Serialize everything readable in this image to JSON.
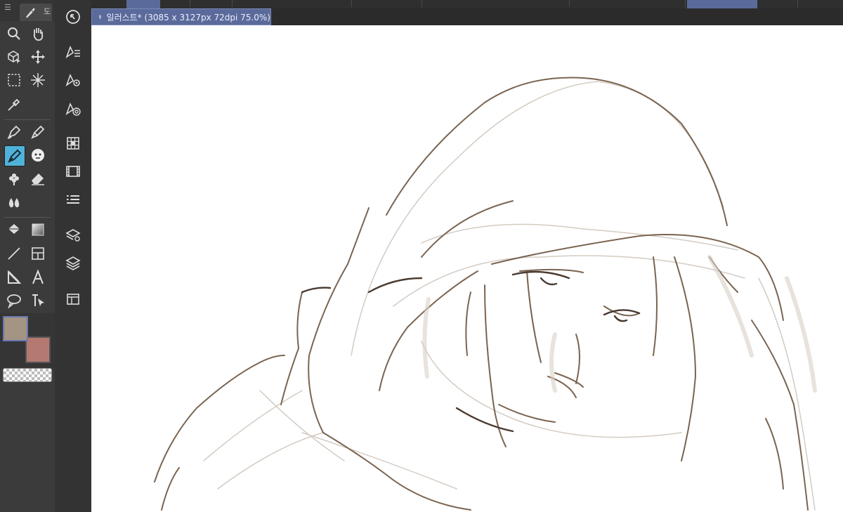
{
  "left_panel": {
    "menu_glyph": "☰",
    "tab_label": "도",
    "tools": [
      {
        "name": "zoom-icon"
      },
      {
        "name": "hand-icon"
      },
      {
        "name": "object-select-icon"
      },
      {
        "name": "move-icon"
      },
      {
        "name": "rect-select-icon"
      },
      {
        "name": "magic-wand-icon"
      },
      {
        "name": "eyedropper-icon"
      },
      {
        "name": "pen-icon"
      },
      {
        "name": "pencil-icon"
      },
      {
        "name": "brush-icon"
      },
      {
        "name": "airbrush-icon"
      },
      {
        "name": "decoration-icon"
      },
      {
        "name": "eraser-icon"
      },
      {
        "name": "blend-icon"
      },
      {
        "name": "fill-icon"
      },
      {
        "name": "gradient-icon"
      },
      {
        "name": "line-icon"
      },
      {
        "name": "frame-icon"
      },
      {
        "name": "ruler-icon"
      },
      {
        "name": "text-icon"
      },
      {
        "name": "balloon-icon"
      },
      {
        "name": "correct-line-icon"
      }
    ],
    "main_color": "#a39484",
    "sub_color": "#b47a72",
    "accent": "#4fb3d9"
  },
  "mid_panel": {
    "items": [
      {
        "name": "navigator-icon"
      },
      {
        "name": "tool-property-icon"
      },
      {
        "name": "sub-tool-detail-icon"
      },
      {
        "name": "brush-size-icon"
      },
      {
        "name": "color-set-icon"
      },
      {
        "name": "timeline-icon"
      },
      {
        "name": "layer-property-icon"
      },
      {
        "name": "layer-search-icon"
      },
      {
        "name": "layer-icon"
      },
      {
        "name": "material-icon"
      }
    ]
  },
  "document": {
    "tab_title": "일러스트* (3085 x 3127px 72dpi 75.0%)"
  },
  "canvas": {
    "background": "#ffffff",
    "stroke_color": "#7a6450"
  }
}
